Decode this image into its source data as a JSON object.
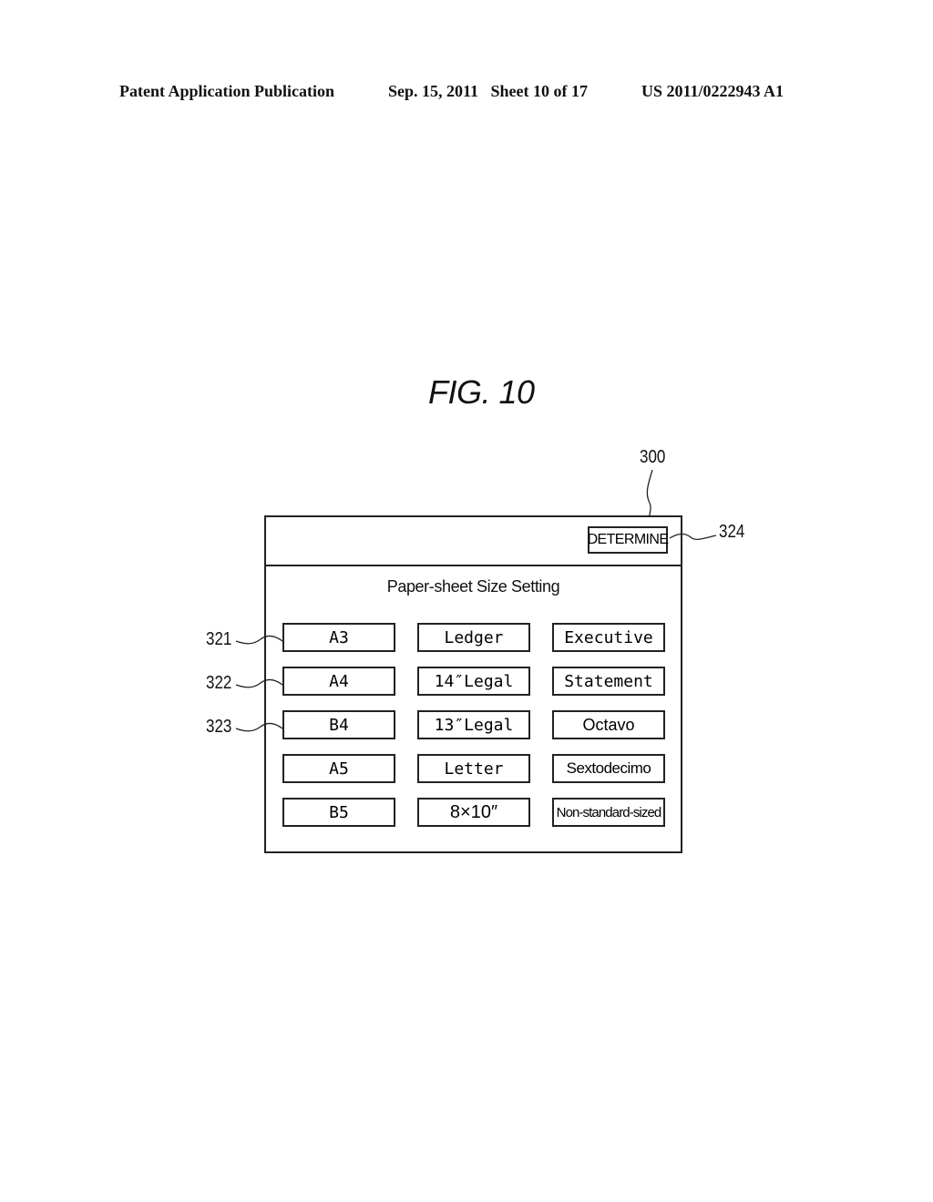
{
  "header": {
    "publication": "Patent Application Publication",
    "date_sheet": "Sep. 15, 2011   Sheet 10 of 17",
    "patent_number": "US 2011/0222943 A1"
  },
  "figure": {
    "title": "FIG. 10"
  },
  "reference_numerals": {
    "window": "300",
    "determine_button": "324",
    "row1": "321",
    "row2": "322",
    "row3": "323"
  },
  "screen": {
    "determine_label": "DETERMINE",
    "heading": "Paper-sheet Size Setting",
    "size_buttons": [
      [
        "A3",
        "Ledger",
        "Executive"
      ],
      [
        "A4",
        "14″Legal",
        "Statement"
      ],
      [
        "B4",
        "13″Legal",
        "Octavo"
      ],
      [
        "A5",
        "Letter",
        "Sextodecimo"
      ],
      [
        "B5",
        "8×10″",
        "Non-standard-sized"
      ]
    ]
  }
}
